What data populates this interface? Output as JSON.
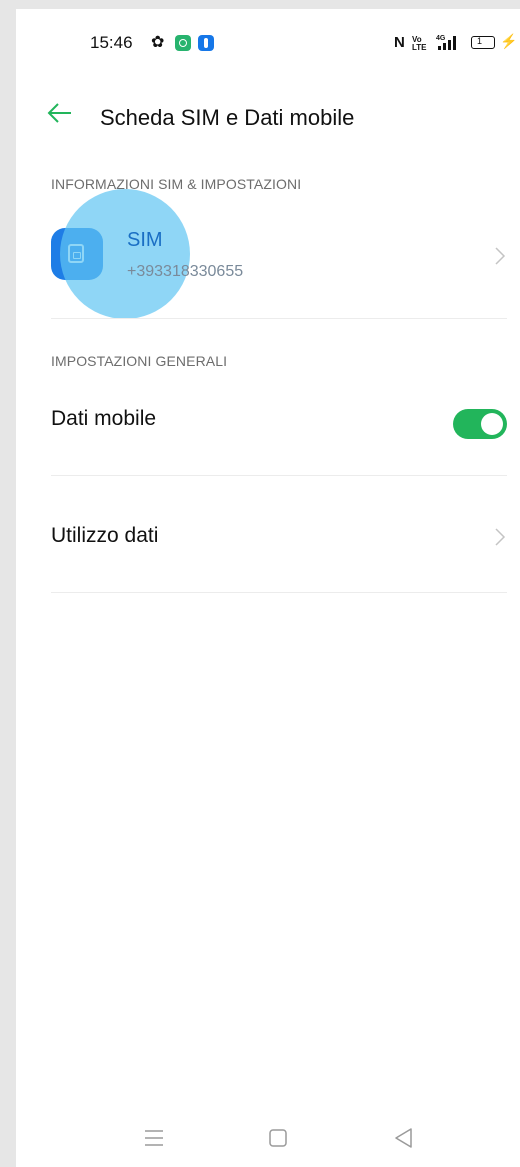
{
  "status_bar": {
    "time": "15:46",
    "icons": [
      "settings-gear-icon",
      "app-notification-icon",
      "usb-icon",
      "nfc-icon",
      "volte-icon",
      "signal-4g-icon",
      "battery-icon",
      "charging-bolt-icon"
    ],
    "nfc_glyph": "N",
    "volte_top": "Vo",
    "volte_bottom": "LTE",
    "network_type": "4G",
    "battery_level_text": "1",
    "bolt_glyph": "⚡"
  },
  "header": {
    "title": "Scheda SIM e Dati mobile"
  },
  "sim_section": {
    "label": "INFORMAZIONI SIM & IMPOSTAZIONI",
    "sim": {
      "name": "SIM",
      "number": "+393318330655"
    }
  },
  "general_section": {
    "label": "IMPOSTAZIONI GENERALI",
    "mobile_data": {
      "label": "Dati mobile",
      "enabled": true
    },
    "data_usage": {
      "label": "Utilizzo dati"
    }
  },
  "colors": {
    "accent_green": "#22b55b",
    "sim_blue": "#1e7de6",
    "touch_ripple": "#5fc4f2"
  },
  "nav_bar": {
    "buttons": [
      "menu-icon",
      "home-icon",
      "back-icon"
    ]
  }
}
